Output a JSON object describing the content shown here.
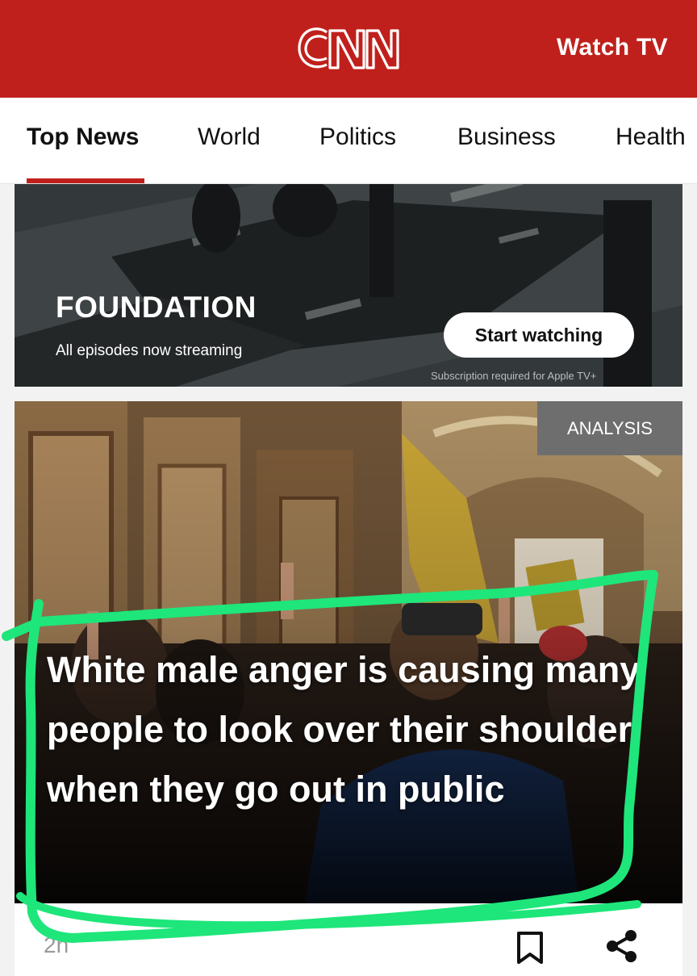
{
  "header": {
    "logo_text": "CNN",
    "watch_tv_label": "Watch TV",
    "brand_color": "#c0201b"
  },
  "nav": {
    "tabs": [
      {
        "label": "Top News",
        "active": true
      },
      {
        "label": "World",
        "active": false
      },
      {
        "label": "Politics",
        "active": false
      },
      {
        "label": "Business",
        "active": false
      },
      {
        "label": "Health",
        "active": false
      }
    ]
  },
  "promo": {
    "title": "FOUNDATION",
    "subtitle": "All episodes now streaming",
    "button_label": "Start watching",
    "note": "Subscription required for Apple TV+"
  },
  "article": {
    "badge": "ANALYSIS",
    "headline": "White male anger is causing many people to look over their shoulder when they go out in public",
    "timestamp": "2h",
    "actions": [
      "bookmark-icon",
      "share-icon"
    ]
  },
  "annotation": {
    "stroke_color": "#1ee67a"
  }
}
